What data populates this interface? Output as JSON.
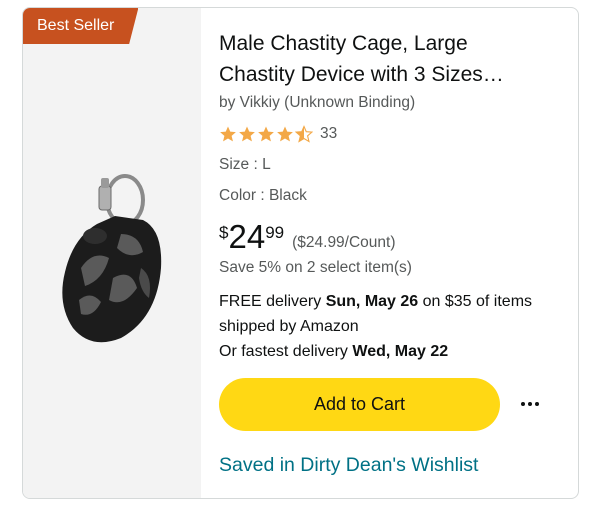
{
  "badge": "Best Seller",
  "product": {
    "title": "Male Chastity Cage, Large Chastity Device with 3 Sizes…",
    "byline": "by Vikkiy (Unknown Binding)",
    "rating_value": 4.5,
    "rating_count": "33",
    "size": "Size : L",
    "color": "Color : Black",
    "image_icon": "product-image"
  },
  "price": {
    "currency": "$",
    "whole": "24",
    "fraction": "99",
    "unit_price": "($24.99/Count)",
    "savings": "Save 5% on 2 select item(s)"
  },
  "delivery": {
    "line1_prefix": "FREE delivery ",
    "line1_date": "Sun, May 26",
    "line1_suffix": " on $35 of items shipped by Amazon",
    "line2_prefix": "Or fastest delivery ",
    "line2_date": "Wed, May 22"
  },
  "actions": {
    "add_to_cart": "Add to Cart",
    "more_icon": "more-options-icon"
  },
  "wishlist": "Saved in Dirty Dean's Wishlist",
  "colors": {
    "badge": "#c7511f",
    "star": "#f3a847",
    "button": "#ffd814",
    "link": "#007185"
  }
}
